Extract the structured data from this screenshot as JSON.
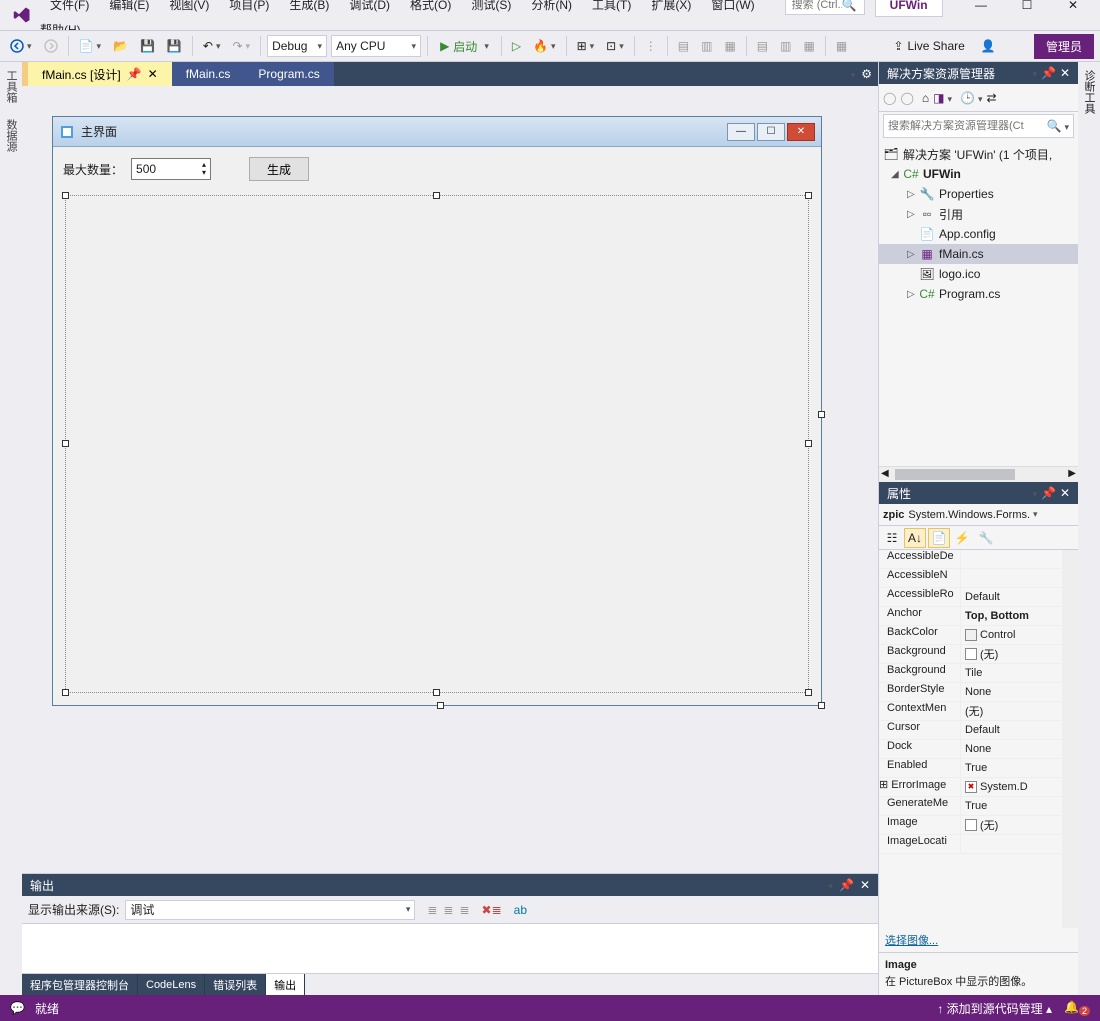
{
  "app": {
    "name": "UFWin"
  },
  "menubar": [
    "文件(F)",
    "编辑(E)",
    "视图(V)",
    "项目(P)",
    "生成(B)",
    "调试(D)",
    "格式(O)",
    "测试(S)",
    "分析(N)",
    "工具(T)",
    "扩展(X)",
    "窗口(W)",
    "帮助(H)"
  ],
  "search": {
    "placeholder": "搜索 (Ctrl..."
  },
  "toolbar": {
    "config": "Debug",
    "platform": "Any CPU",
    "start": "启动",
    "liveshare": "Live Share",
    "admin": "管理员"
  },
  "left_tabs": [
    "工具箱",
    "数据源"
  ],
  "right_tabs": [
    "诊断工具"
  ],
  "editor_tabs": [
    {
      "label": "fMain.cs [设计]",
      "active": true
    },
    {
      "label": "fMain.cs",
      "active": false
    },
    {
      "label": "Program.cs",
      "active": false
    }
  ],
  "form": {
    "title": "主界面",
    "max_label": "最大数量：",
    "max_value": "500",
    "gen_button": "生成"
  },
  "output": {
    "title": "输出",
    "source_label": "显示输出来源(S):",
    "source_value": "调试"
  },
  "bottom_tabs": [
    "程序包管理器控制台",
    "CodeLens",
    "错误列表",
    "输出"
  ],
  "solution": {
    "title": "解决方案资源管理器",
    "search_placeholder": "搜索解决方案资源管理器(Ct",
    "root": "解决方案 'UFWin' (1 个项目,",
    "project": "UFWin",
    "nodes": [
      "Properties",
      "引用",
      "App.config",
      "fMain.cs",
      "logo.ico",
      "Program.cs"
    ]
  },
  "properties": {
    "title": "属性",
    "object_name": "zpic",
    "object_type": "System.Windows.Forms.",
    "rows": [
      {
        "k": "AccessibleDe",
        "v": ""
      },
      {
        "k": "AccessibleN",
        "v": ""
      },
      {
        "k": "AccessibleRo",
        "v": "Default"
      },
      {
        "k": "Anchor",
        "v": "Top, Bottom",
        "bold": true
      },
      {
        "k": "BackColor",
        "v": "Control",
        "color": "#f0f0f0"
      },
      {
        "k": "Background",
        "v": "(无)",
        "color": "#fff"
      },
      {
        "k": "Background",
        "v": "Tile"
      },
      {
        "k": "BorderStyle",
        "v": "None"
      },
      {
        "k": "ContextMen",
        "v": "(无)"
      },
      {
        "k": "Cursor",
        "v": "Default"
      },
      {
        "k": "Dock",
        "v": "None"
      },
      {
        "k": "Enabled",
        "v": "True"
      },
      {
        "k": "ErrorImage",
        "v": "System.D",
        "expand": true,
        "errimg": true
      },
      {
        "k": "GenerateMe",
        "v": "True"
      },
      {
        "k": "Image",
        "v": "(无)",
        "color": "#fff"
      },
      {
        "k": "ImageLocati",
        "v": ""
      }
    ],
    "link": "选择图像...",
    "desc_title": "Image",
    "desc_text": "在 PictureBox 中显示的图像。"
  },
  "statusbar": {
    "ready": "就绪",
    "scm": "添加到源代码管理",
    "notif": "2"
  }
}
